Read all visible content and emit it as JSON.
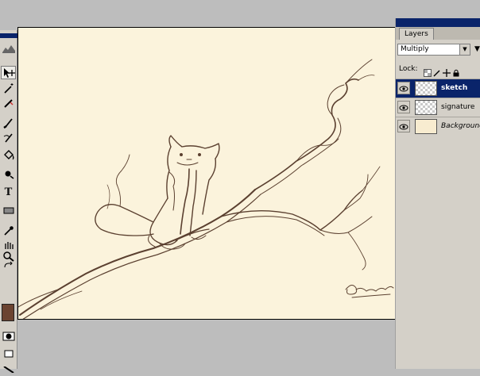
{
  "toolbox": {
    "tools": [
      {
        "icon": "move-icon"
      },
      {
        "icon": "magic-wand-icon"
      },
      {
        "icon": "healing-brush-icon"
      },
      {
        "icon": "brush-icon"
      },
      {
        "icon": "history-brush-icon"
      },
      {
        "icon": "paint-bucket-icon"
      },
      {
        "icon": "burn-icon"
      },
      {
        "icon": "type-icon",
        "label": "T"
      },
      {
        "icon": "rectangle-shape-icon"
      },
      {
        "icon": "eyedropper-icon"
      },
      {
        "icon": "hand-icon"
      },
      {
        "icon": "zoom-icon"
      }
    ],
    "foreground_color": "#6b4331"
  },
  "document": {
    "canvas_color": "#fbf3dc",
    "ink_color": "#5b4030"
  },
  "layers_panel": {
    "tab_label": "Layers",
    "blend_mode": "Multiply",
    "lock_label": "Lock:",
    "layers": [
      {
        "name": "sketch",
        "selected": true,
        "thumb": "transparent"
      },
      {
        "name": "signature",
        "selected": false,
        "thumb": "transparent"
      },
      {
        "name": "Background",
        "selected": false,
        "thumb": "fill"
      }
    ]
  }
}
